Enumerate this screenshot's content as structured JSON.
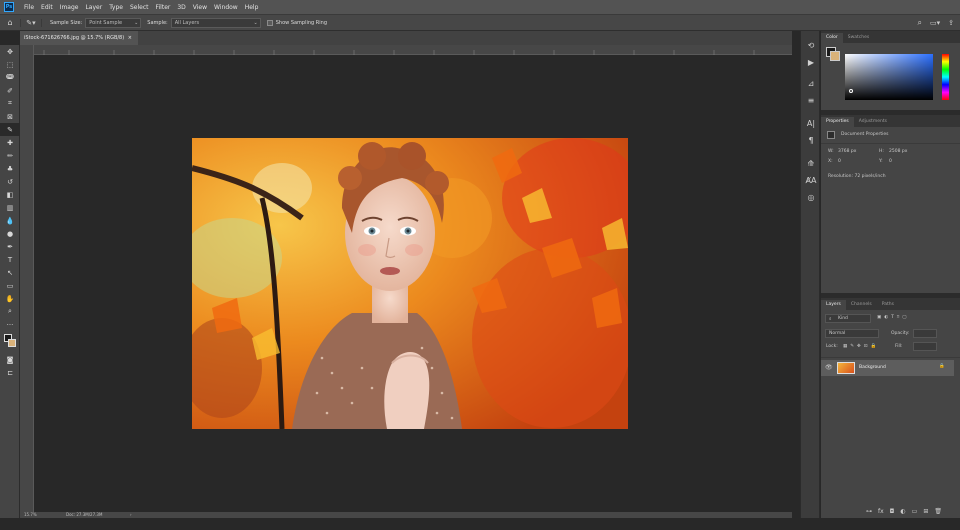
{
  "app": {
    "logo": "Ps"
  },
  "menu": [
    "File",
    "Edit",
    "Image",
    "Layer",
    "Type",
    "Select",
    "Filter",
    "3D",
    "View",
    "Window",
    "Help"
  ],
  "options": {
    "sample_size_label": "Sample Size:",
    "sample_size_value": "Point Sample",
    "sample_label": "Sample:",
    "sample_value": "All Layers",
    "show_ring_label": "Show Sampling Ring"
  },
  "document": {
    "tab_title": "iStock-671626766.jpg @ 15.7% (RGB/8)",
    "close": "×",
    "status": "Doc: 27.3M/27.3M"
  },
  "color_panel": {
    "tabs": [
      "Color",
      "Swatches"
    ]
  },
  "properties_panel": {
    "tabs": [
      "Properties",
      "Adjustments"
    ],
    "title": "Document Properties",
    "w_label": "W:",
    "w_value": "3768 px",
    "h_label": "H:",
    "h_value": "2508 px",
    "x_label": "X:",
    "x_value": "0",
    "y_label": "Y:",
    "y_value": "0",
    "resolution": "Resolution: 72 pixels/inch"
  },
  "layers_panel": {
    "tabs": [
      "Layers",
      "Channels",
      "Paths"
    ],
    "kind_placeholder": "Kind",
    "blend_mode": "Normal",
    "opacity_label": "Opacity:",
    "lock_label": "Lock:",
    "fill_label": "Fill:",
    "layer_name": "Background"
  },
  "colors": {
    "accent": "#31a8ff",
    "bg": "#282828",
    "panel": "#454545"
  }
}
